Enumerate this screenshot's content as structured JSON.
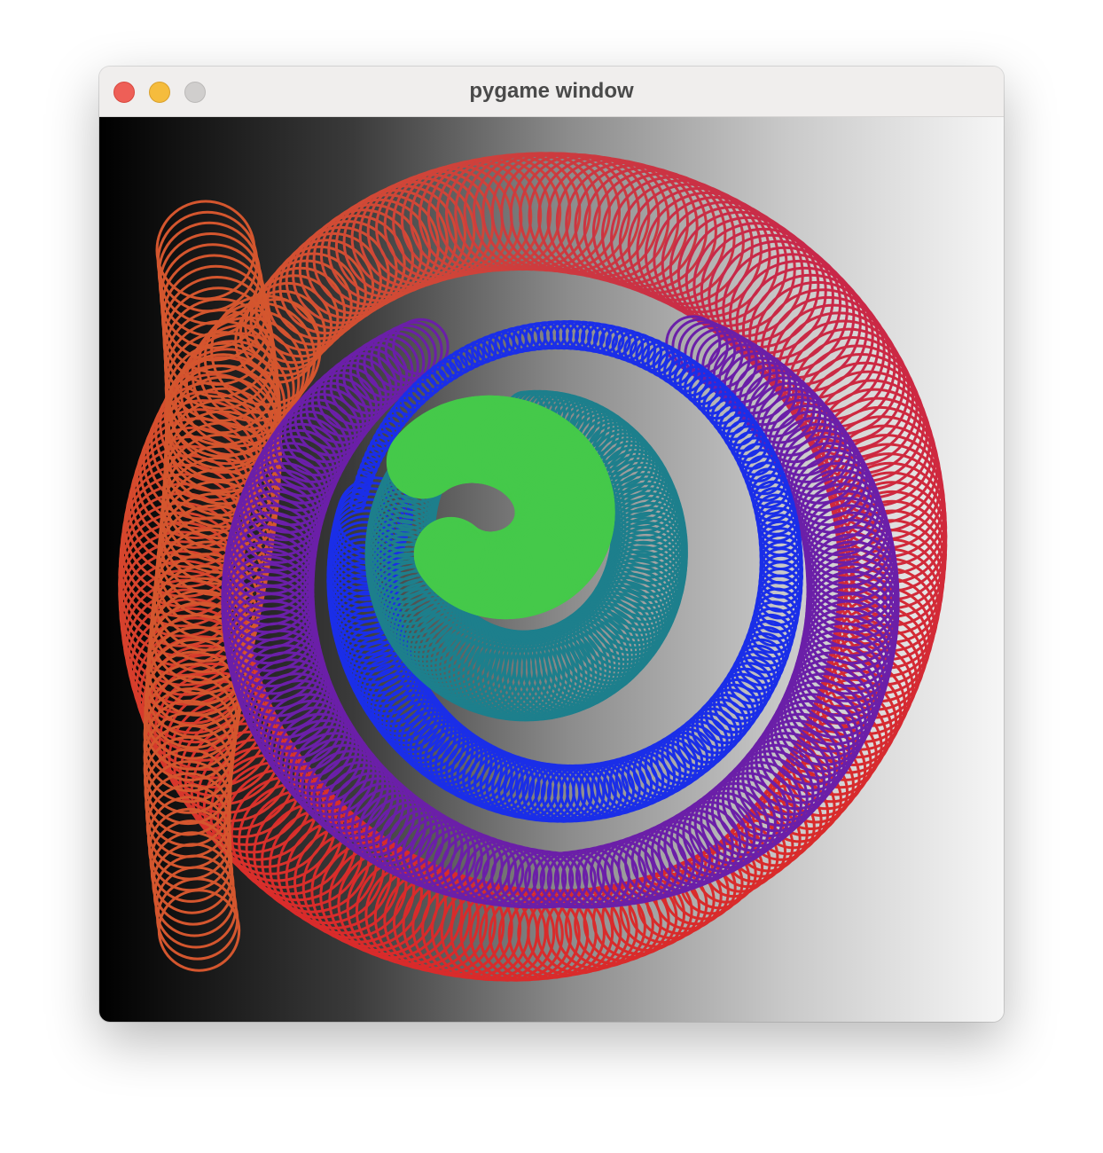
{
  "window": {
    "title": "pygame window"
  },
  "controls": {
    "close": "close-button",
    "minimize": "minimize-button",
    "zoom": "zoom-button"
  },
  "colors": {
    "titlebar_bg": "#f0eeed",
    "title_text": "#4a4a4a",
    "close": "#ee5f57",
    "minimize": "#f5bc3d",
    "zoom": "#d0cecd",
    "gradient_left": "#000000",
    "gradient_right": "#f6f6f6",
    "ring_orange": "#d4562e",
    "ring_red": "#d92b2b",
    "ring_crimson": "#c8284a",
    "ring_purple": "#6b1fa8",
    "ring_blue": "#1a2ee8",
    "ring_teal": "#1d7f8c",
    "ring_green": "#45c94a"
  }
}
